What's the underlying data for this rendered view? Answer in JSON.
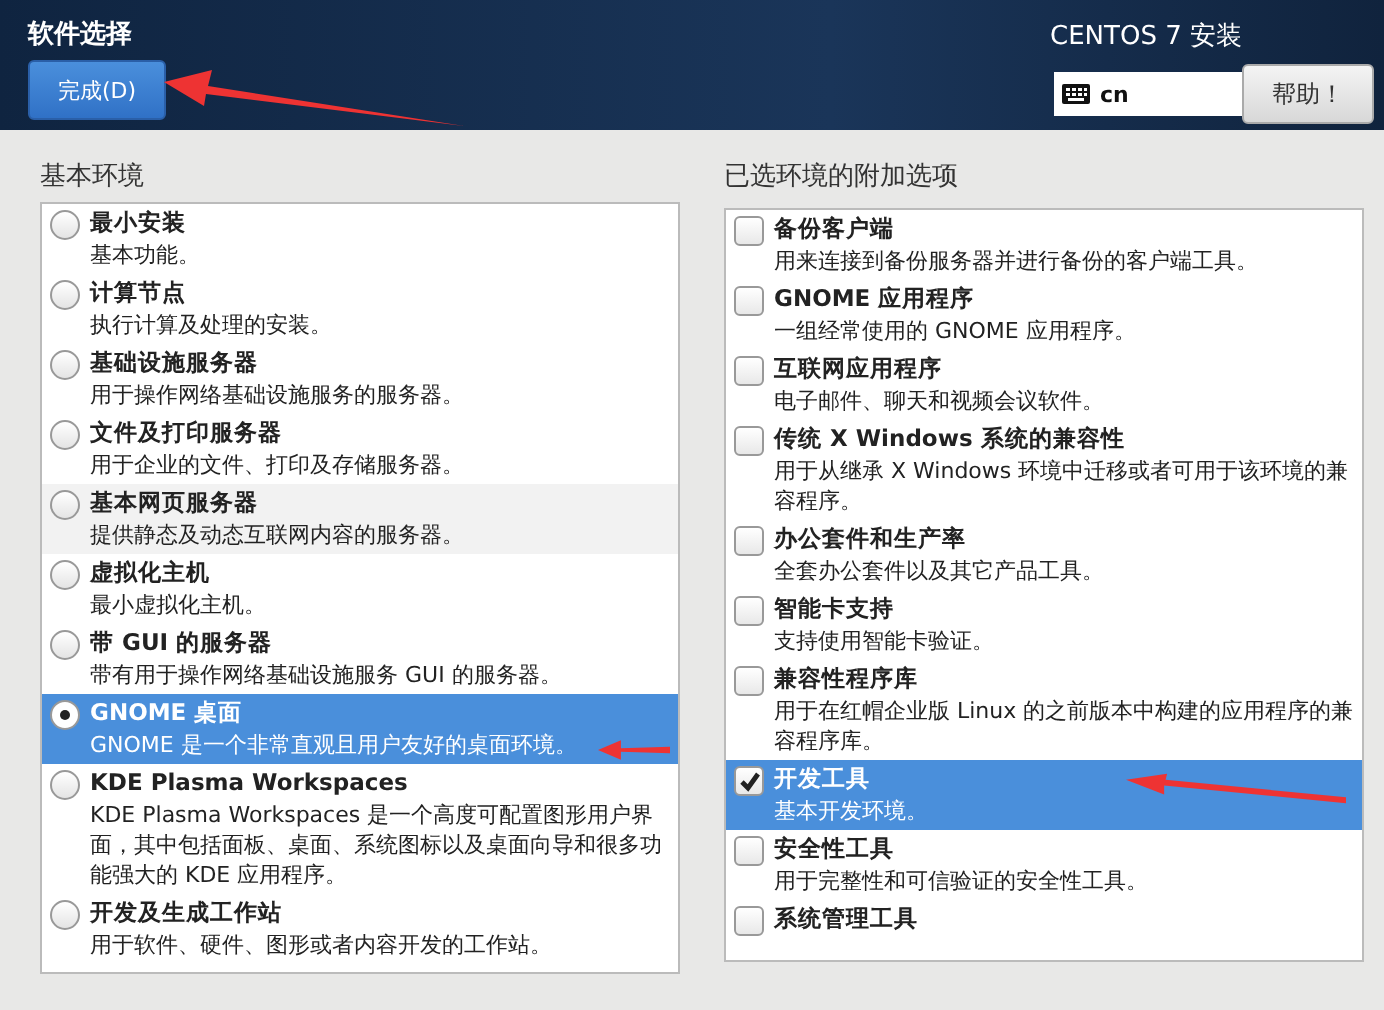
{
  "header": {
    "title": "软件选择",
    "done_button": "完成(D)",
    "product": "CENTOS 7 安装",
    "keyboard_layout": "cn",
    "help_button": "帮助！"
  },
  "environments": {
    "heading": "基本环境",
    "items": [
      {
        "name": "最小安装",
        "description": "基本功能。",
        "selected": false
      },
      {
        "name": "计算节点",
        "description": "执行计算及处理的安装。",
        "selected": false
      },
      {
        "name": "基础设施服务器",
        "description": "用于操作网络基础设施服务的服务器。",
        "selected": false
      },
      {
        "name": "文件及打印服务器",
        "description": "用于企业的文件、打印及存储服务器。",
        "selected": false
      },
      {
        "name": "基本网页服务器",
        "description": "提供静态及动态互联网内容的服务器。",
        "selected": false
      },
      {
        "name": "虚拟化主机",
        "description": "最小虚拟化主机。",
        "selected": false
      },
      {
        "name": "带 GUI 的服务器",
        "description": "带有用于操作网络基础设施服务 GUI 的服务器。",
        "selected": false
      },
      {
        "name": "GNOME 桌面",
        "description": "GNOME 是一个非常直观且用户友好的桌面环境。",
        "selected": true
      },
      {
        "name": "KDE Plasma Workspaces",
        "description": "KDE Plasma Workspaces 是一个高度可配置图形用户界面，其中包括面板、桌面、系统图标以及桌面向导和很多功能强大的 KDE 应用程序。",
        "selected": false
      },
      {
        "name": "开发及生成工作站",
        "description": "用于软件、硬件、图形或者内容开发的工作站。",
        "selected": false
      }
    ]
  },
  "addons": {
    "heading": "已选环境的附加选项",
    "items": [
      {
        "name": "备份客户端",
        "description": "用来连接到备份服务器并进行备份的客户端工具。",
        "checked": false,
        "selected": false
      },
      {
        "name": "GNOME 应用程序",
        "description": "一组经常使用的 GNOME 应用程序。",
        "checked": false,
        "selected": false
      },
      {
        "name": "互联网应用程序",
        "description": "电子邮件、聊天和视频会议软件。",
        "checked": false,
        "selected": false
      },
      {
        "name": "传统 X Windows 系统的兼容性",
        "description": "用于从继承 X Windows 环境中迁移或者可用于该环境的兼容程序。",
        "checked": false,
        "selected": false
      },
      {
        "name": "办公套件和生产率",
        "description": "全套办公套件以及其它产品工具。",
        "checked": false,
        "selected": false
      },
      {
        "name": "智能卡支持",
        "description": "支持使用智能卡验证。",
        "checked": false,
        "selected": false
      },
      {
        "name": "兼容性程序库",
        "description": "用于在红帽企业版 Linux 的之前版本中构建的应用程序的兼容程序库。",
        "checked": false,
        "selected": false
      },
      {
        "name": "开发工具",
        "description": "基本开发环境。",
        "checked": true,
        "selected": true
      },
      {
        "name": "安全性工具",
        "description": "用于完整性和可信验证的安全性工具。",
        "checked": false,
        "selected": false
      },
      {
        "name": "系统管理工具",
        "checked": false,
        "selected": false
      }
    ]
  }
}
